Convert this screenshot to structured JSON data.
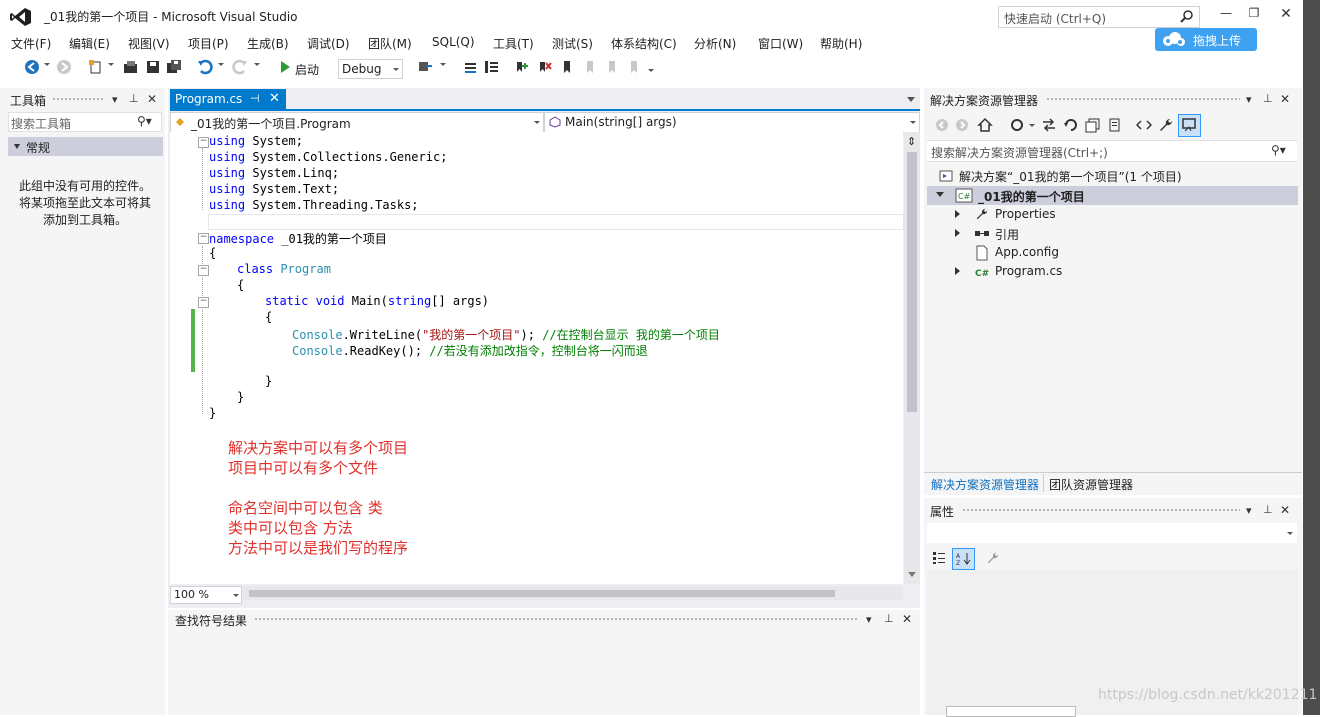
{
  "window": {
    "title": "_01我的第一个项目 - Microsoft Visual Studio",
    "quick_launch_placeholder": "快速启动 (Ctrl+Q)",
    "upload_label": "拖拽上传"
  },
  "menu": [
    "文件(F)",
    "编辑(E)",
    "视图(V)",
    "项目(P)",
    "生成(B)",
    "调试(D)",
    "团队(M)",
    "SQL(Q)",
    "工具(T)",
    "测试(S)",
    "体系结构(C)",
    "分析(N)",
    "窗口(W)",
    "帮助(H)"
  ],
  "toolbar": {
    "start_label": "启动",
    "configuration": "Debug"
  },
  "toolbox": {
    "title": "工具箱",
    "search_placeholder": "搜索工具箱",
    "group": "常规",
    "empty_line1": "此组中没有可用的控件。",
    "empty_line2": "将某项拖至此文本可将其",
    "empty_line3": "添加到工具箱。"
  },
  "editor": {
    "tab_label": "Program.cs",
    "nav_left": "_01我的第一个项目.Program",
    "nav_right": "Main(string[] args)",
    "zoom": "100 %",
    "code": {
      "u1": "System;",
      "u2": "System.Collections.Generic;",
      "u3": "System.Linq;",
      "u4": "System.Text;",
      "u5": "System.Threading.Tasks;",
      "kw_using": "using",
      "kw_namespace": "namespace",
      "ns_name": " _01我的第一个项目",
      "brace_open": "{",
      "brace_close": "}",
      "kw_class": "class",
      "class_name": "Program",
      "kw_static": "static",
      "kw_void": "void",
      "main_sig_a": "Main(",
      "kw_string": "string",
      "main_sig_b": "[] args)",
      "type_console": "Console",
      "writeline": ".WriteLine(",
      "str_value": "\"我的第一个项目\"",
      "writeline_end": ");",
      "comment1": "//在控制台显示 我的第一个项目",
      "readkey": ".ReadKey();",
      "comment2": "//若没有添加改指令，控制台将一闪而退"
    },
    "notes": [
      "解决方案中可以有多个项目",
      "项目中可以有多个文件",
      "",
      "命名空间中可以包含 类",
      "类中可以包含 方法",
      "方法中可以是我们写的程序"
    ]
  },
  "find_results": {
    "title": "查找符号结果"
  },
  "solution_explorer": {
    "title": "解决方案资源管理器",
    "search_placeholder": "搜索解决方案资源管理器(Ctrl+;)",
    "solution_label": "解决方案“_01我的第一个项目”(1 个项目)",
    "project_label": "_01我的第一个项目",
    "items": [
      "Properties",
      "引用",
      "App.config",
      "Program.cs"
    ],
    "tab_active": "解决方案资源管理器",
    "tab_other": "团队资源管理器"
  },
  "properties": {
    "title": "属性"
  },
  "watermark": "https://blog.csdn.net/kk201211"
}
